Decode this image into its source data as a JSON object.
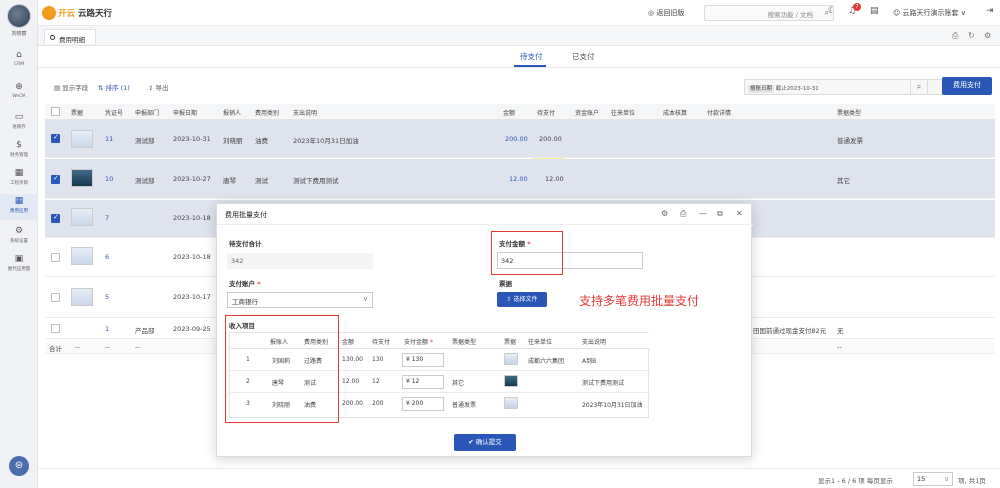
{
  "sidebar": {
    "user": "刘晓丽",
    "items": [
      {
        "label": "CRM",
        "icon": "crm-icon"
      },
      {
        "label": "WeOA",
        "icon": "weoa-icon"
      },
      {
        "label": "进销存",
        "icon": "inventory-icon"
      },
      {
        "label": "财务管理",
        "icon": "finance-icon"
      },
      {
        "label": "工程项目",
        "icon": "project-icon"
      },
      {
        "label": "费用应用",
        "icon": "expense-icon"
      },
      {
        "label": "系统设置",
        "icon": "settings-icon"
      },
      {
        "label": "图代应用量",
        "icon": "app-icon"
      }
    ]
  },
  "header": {
    "brand_prefix": "开云",
    "brand": "云路天行",
    "back_link": "返回旧版",
    "search_placeholder": "搜索功能 / 文档",
    "notif_count": "7",
    "user_menu": "云路天行演示账套 ∨"
  },
  "tabstrip": {
    "page_tab": "费用明细"
  },
  "pay_tabs": [
    "待支付",
    "已支付"
  ],
  "toolbar": {
    "show_fields": "显示字段",
    "sort": "排序",
    "sort_count": "1",
    "export": "导出",
    "date_label": "报账日期",
    "date_value": "截止2023-10-31",
    "pay_button": "费用支付"
  },
  "table": {
    "headers": [
      "票据",
      "凭证号",
      "申报部门",
      "申报日期",
      "报销人",
      "费用类别",
      "支出说明",
      "金额",
      "待支付",
      "资金账户",
      "往来单位",
      "成本核算",
      "付款详情",
      "票据类型"
    ],
    "rows": [
      {
        "selected": true,
        "voucher": "11",
        "dept": "测试部",
        "date": "2023-10-31",
        "person": "刘晓丽",
        "category": "油费",
        "desc": "2023年10月31日加油",
        "amount": "200.00",
        "pending": "200.00",
        "invoice_type": "普通发票"
      },
      {
        "selected": true,
        "voucher": "10",
        "dept": "测试部",
        "date": "2023-10-27",
        "person": "唐琴",
        "category": "测试",
        "desc": "测试下费用测试",
        "amount": "12.00",
        "pending": "12.00",
        "invoice_type": "其它"
      },
      {
        "selected": true,
        "voucher": "7",
        "dept": "",
        "date": "2023-10-18",
        "person": "",
        "category": "",
        "desc": "",
        "amount": "",
        "pending": "",
        "invoice_type": ""
      },
      {
        "selected": false,
        "voucher": "6",
        "dept": "",
        "date": "2023-10-18",
        "person": "",
        "category": "",
        "desc": "",
        "amount": "",
        "pending": "",
        "invoice_type": ""
      },
      {
        "selected": false,
        "voucher": "5",
        "dept": "",
        "date": "2023-10-17",
        "person": "",
        "category": "",
        "desc": "",
        "amount": "",
        "pending": "",
        "invoice_type": ""
      },
      {
        "selected": false,
        "voucher": "1",
        "dept": "产品部",
        "date": "2023-09-25",
        "person": "",
        "category": "",
        "desc": "",
        "amount": "",
        "pending": "",
        "invoice_type": "无",
        "detail": "田国前通过现金支付82元"
      }
    ],
    "sum_label": "合计",
    "sum_cells": [
      "--",
      "--",
      "--",
      "--"
    ]
  },
  "footer": {
    "summary": "显示1 - 6 / 6 项  每页显示",
    "page_size": "15",
    "tail": "项, 共1页"
  },
  "modal": {
    "title": "费用批量支付",
    "total_label": "待支付合计",
    "total_value": "342",
    "pay_amount_label": "支付金额",
    "pay_amount_value": "342",
    "account_label": "支付账户",
    "account_value": "工商银行",
    "receipt_label": "票据",
    "upload_button": "选择文件",
    "callout": "支持多笔费用批量支付",
    "items_label": "收入项目",
    "item_headers": [
      "报账人",
      "费用类别",
      "金额",
      "待支付",
      "支付金额",
      "票据类型",
      "票据",
      "往来单位",
      "支出说明"
    ],
    "items": [
      {
        "no": "1",
        "person": "刘国莉",
        "category": "过路费",
        "amount": "130.00",
        "pending": "130",
        "pay": "¥  130",
        "type": "",
        "unit": "成都六六集团",
        "desc": "A到B"
      },
      {
        "no": "2",
        "person": "唐琴",
        "category": "测试",
        "amount": "12.00",
        "pending": "12",
        "pay": "¥  12",
        "type": "其它",
        "unit": "",
        "desc": "测试下费用测试"
      },
      {
        "no": "3",
        "person": "刘晓丽",
        "category": "油费",
        "amount": "200.00",
        "pending": "200",
        "pay": "¥  200",
        "type": "普通发票",
        "unit": "",
        "desc": "2023年10月31日加油"
      }
    ],
    "confirm_button": "确认提交"
  }
}
